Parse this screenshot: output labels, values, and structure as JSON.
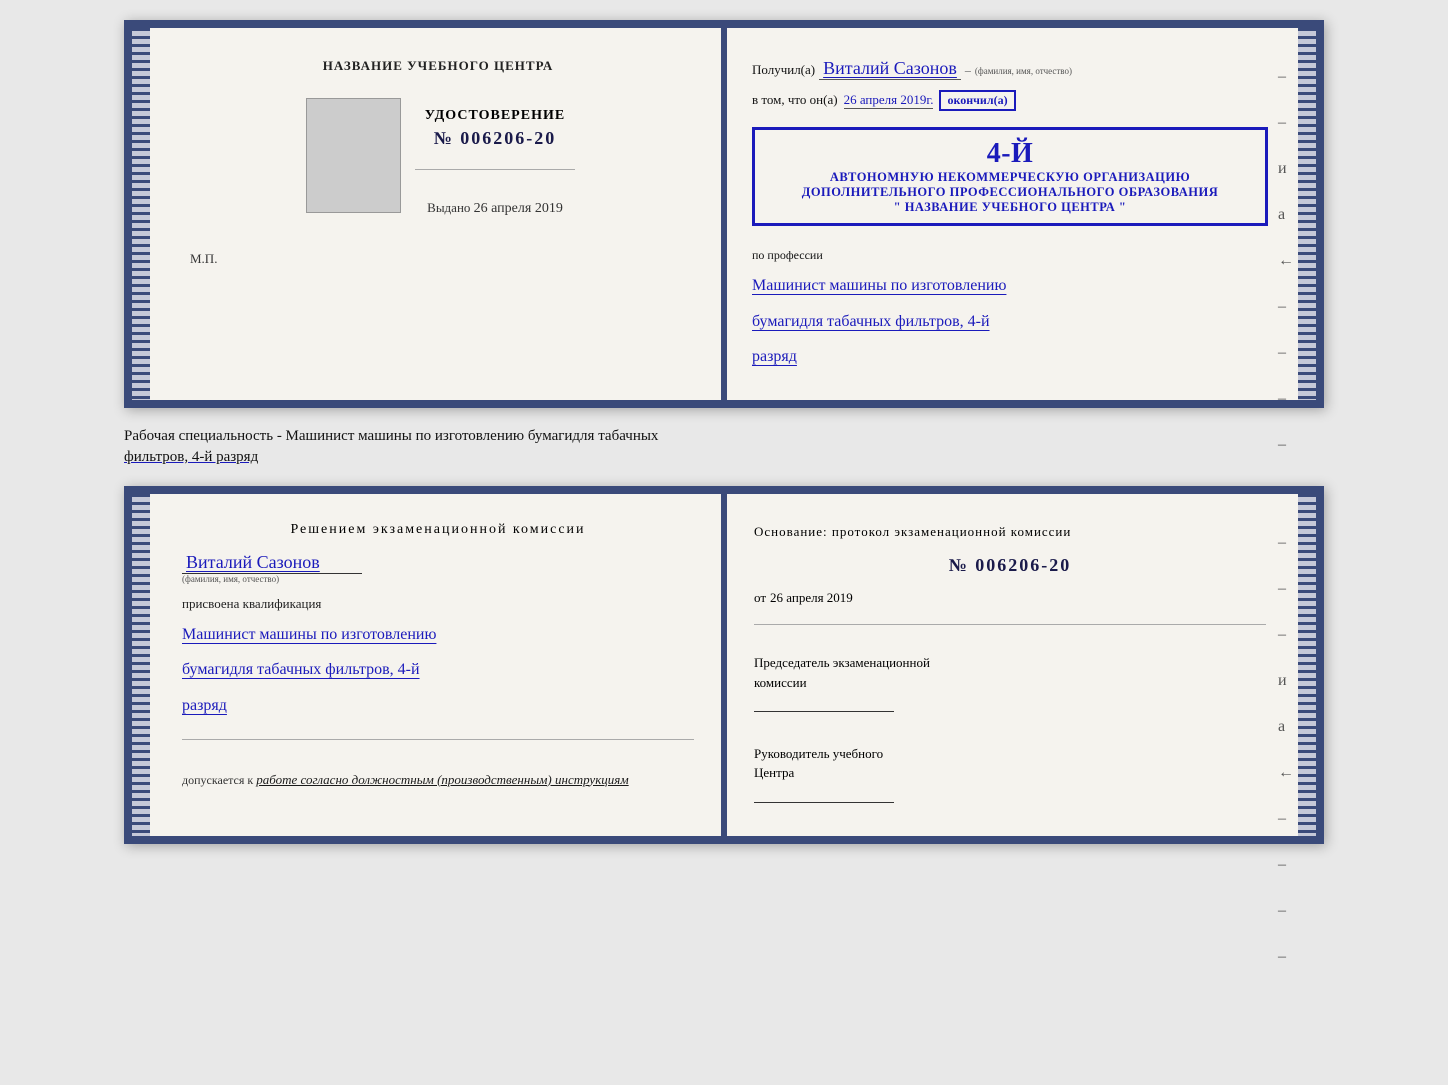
{
  "topBook": {
    "left": {
      "centerLabel": "НАЗВАНИЕ УЧЕБНОГО ЦЕНТРА",
      "udostTitle": "УДОСТОВЕРЕНИЕ",
      "udostNumber": "№ 006206-20",
      "vydanoLabel": "Выдано",
      "vydanoDate": "26 апреля 2019",
      "mp": "М.П."
    },
    "right": {
      "poluchilLabel": "Получил(а)",
      "recipientName": "Виталий Сазонов",
      "fioCaption": "(фамилия, имя, отчество)",
      "vtomLabel": "в том, что он(а)",
      "date": "26 апреля 2019г.",
      "okonchilLabel": "окончил(а)",
      "stampLine1": "АВТОНОМНУЮ НЕКОММЕРЧЕСКУЮ ОРГАНИЗАЦИЮ",
      "stampLine2": "ДОПОЛНИТЕЛЬНОГО ПРОФЕССИОНАЛЬНОГО ОБРАЗОВАНИЯ",
      "stampLine3": "\" НАЗВАНИЕ УЧЕБНОГО ЦЕНТРА \"",
      "stampHighlight": "4-й",
      "poProfessiiLabel": "по профессии",
      "profLine1": "Машинист машины по изготовлению",
      "profLine2": "бумагидля табачных фильтров, 4-й",
      "profLine3": "разряд"
    }
  },
  "subtitle": {
    "text1": "Рабочая специальность - Машинист машины по изготовлению бумагидля табачных",
    "text2": "фильтров, 4-й разряд"
  },
  "bottomBook": {
    "left": {
      "resheniemTitle": "Решением экзаменационной комиссии",
      "recipientName": "Виталий Сазонов",
      "fioCaption": "(фамилия, имя, отчество)",
      "prisvoenoLabel": "присвоена квалификация",
      "qualLine1": "Машинист машины по изготовлению",
      "qualLine2": "бумагидля табачных фильтров, 4-й",
      "qualLine3": "разряд",
      "dopuskaetsyaLabel": "допускается к",
      "dopuskaetsyaText": "работе согласно должностным (производственным) инструкциям"
    },
    "right": {
      "osnovanieLabelLine1": "Основание: протокол экзаменационной комиссии",
      "protocolNumber": "№ 006206-20",
      "otLabel": "от",
      "otDate": "26 апреля 2019",
      "predsedatelLabel": "Председатель экзаменационной",
      "predsedatelLabel2": "комиссии",
      "rukovoditelLabel": "Руководитель учебного",
      "rukovoditelLabel2": "Центра"
    }
  }
}
